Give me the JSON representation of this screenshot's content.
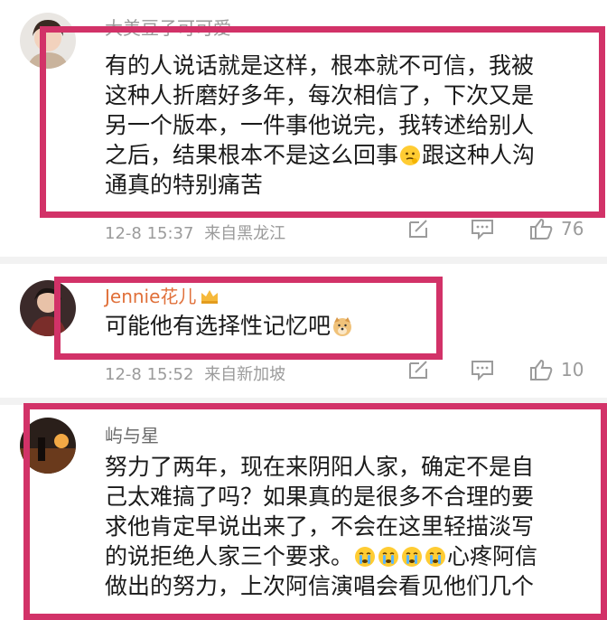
{
  "comments": [
    {
      "username": "大美豆子可可爱",
      "lines": [
        "有的人说话就是这样，根本就不可信，我被",
        "这种人折磨好多年，每次相信了，下次又是",
        "另一个版本，一件事他说完，我转述给别人",
        "之后，结果根本不是这么回事",
        "通真的特别痛苦"
      ],
      "line4_after_emoji": "跟这种人沟",
      "inline_emoji": "thinking-face",
      "timestamp": "12-8 15:37",
      "source": "来自黑龙江",
      "likes": "76"
    },
    {
      "username": "Jennie花儿",
      "user_badge": "crown-badge",
      "lines": [
        "可能他有选择性记忆吧"
      ],
      "inline_emoji": "doge",
      "timestamp": "12-8 15:52",
      "source": "来自新加坡",
      "likes": "10"
    },
    {
      "username": "屿与星",
      "lines": [
        "努力了两年，现在来阴阳人家，确定不是自",
        "己太难搞了吗？如果真的是很多不合理的要",
        "求他肯定早说出来了，不会在这里轻描淡写",
        "的说拒绝人家三个要求。",
        "做出的努力，上次阿信演唱会看见他们几个"
      ],
      "line4_after_emoji": "心疼阿信",
      "inline_emoji": "crying-face",
      "inline_emoji_count": 4
    }
  ],
  "colors": {
    "highlight_border": "#d23268",
    "meta_text": "#9b9b9b",
    "username_text": "#6b6b6b",
    "body_text": "#1a1a1a"
  }
}
